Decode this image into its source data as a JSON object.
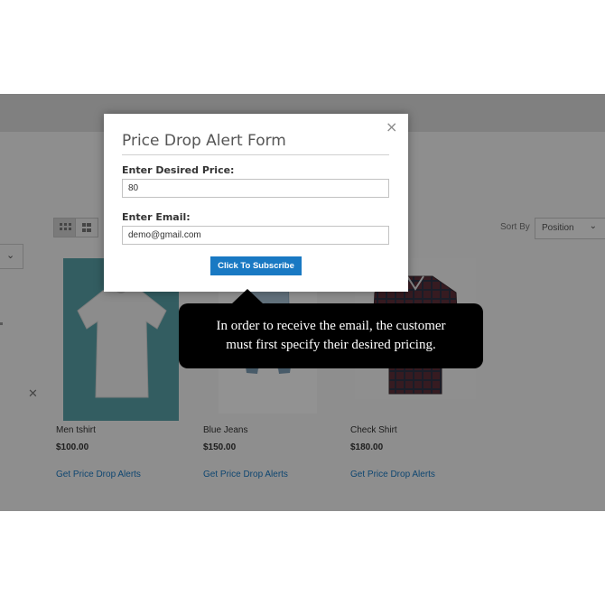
{
  "shop": {
    "sort_label": "Sort By",
    "sort_value": "Position",
    "products": [
      {
        "name": "Men tshirt",
        "price": "$100.00",
        "link": "Get Price Drop Alerts"
      },
      {
        "name": "Blue Jeans",
        "price": "$150.00",
        "link": "Get Price Drop Alerts"
      },
      {
        "name": "Check Shirt",
        "price": "$180.00",
        "link": "Get Price Drop Alerts"
      }
    ]
  },
  "modal": {
    "title": "Price Drop Alert Form",
    "close_glyph": "×",
    "price_label": "Enter Desired Price:",
    "price_value": "80",
    "email_label": "Enter Email:",
    "email_value": "demo@gmail.com",
    "subscribe_label": "Click To Subscribe"
  },
  "callout": {
    "line1": "In order to receive the email, the customer",
    "line2": "must first specify their desired pricing."
  },
  "colors": {
    "accent": "#1979c3",
    "overlay": "#000000",
    "tshirt_bg": "#59a1a8"
  },
  "icons": [
    "grid-view-icon",
    "list-view-icon",
    "chevron-down-icon",
    "close-icon"
  ]
}
